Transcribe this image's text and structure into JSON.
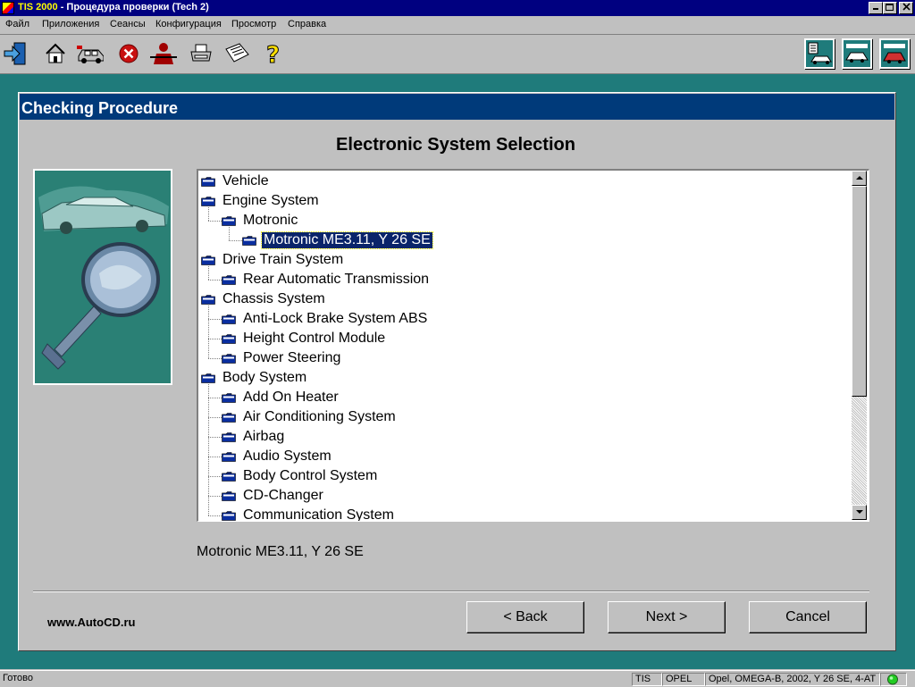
{
  "window": {
    "app_name": "TIS 2000",
    "title_rest": " - Процедура проверки (Tech 2)"
  },
  "menu": [
    "Файл",
    "Приложения",
    "Сеансы",
    "Конфигурация",
    "Просмотр",
    "Справка"
  ],
  "toolbar_left_icons": [
    "exit-icon",
    "home-icon",
    "vehicle-icon",
    "stop-icon",
    "person-icon",
    "printer-icon",
    "notepad-icon",
    "help-icon"
  ],
  "toolbar_right_icons": [
    "tech2-mode-icon",
    "vehicle-mode-icon",
    "car-mode-icon"
  ],
  "dialog": {
    "header": "Checking Procedure",
    "title": "Electronic System Selection",
    "selected_text": "Motronic ME3.11, Y 26 SE",
    "footer_link": "www.AutoCD.ru",
    "buttons": {
      "back": "< Back",
      "next": "Next >",
      "cancel": "Cancel"
    }
  },
  "tree": [
    {
      "label": "Vehicle",
      "level": 0
    },
    {
      "label": "Engine System",
      "level": 0
    },
    {
      "label": "Motronic",
      "level": 1
    },
    {
      "label": "Motronic ME3.11, Y 26 SE",
      "level": 2,
      "selected": true
    },
    {
      "label": "Drive Train System",
      "level": 0
    },
    {
      "label": "Rear Automatic Transmission",
      "level": 1
    },
    {
      "label": "Chassis System",
      "level": 0
    },
    {
      "label": "Anti-Lock Brake System ABS",
      "level": 1
    },
    {
      "label": "Height Control Module",
      "level": 1
    },
    {
      "label": "Power Steering",
      "level": 1
    },
    {
      "label": "Body System",
      "level": 0
    },
    {
      "label": "Add On Heater",
      "level": 1
    },
    {
      "label": "Air Conditioning System",
      "level": 1
    },
    {
      "label": "Airbag",
      "level": 1
    },
    {
      "label": "Audio System",
      "level": 1
    },
    {
      "label": "Body Control System",
      "level": 1
    },
    {
      "label": "CD-Changer",
      "level": 1
    },
    {
      "label": "Communication System",
      "level": 1
    }
  ],
  "statusbar": {
    "status": "Готово",
    "app": "TIS",
    "make": "OPEL",
    "vehicle": "Opel, OMEGA-B, 2002, Y 26 SE, 4-AT"
  },
  "colors": {
    "desktop": "#1f7b7b",
    "dialog_header": "#003a7a",
    "selection": "#0a246a",
    "folder": "#0a2ea0",
    "status_led": "#22cc22"
  }
}
